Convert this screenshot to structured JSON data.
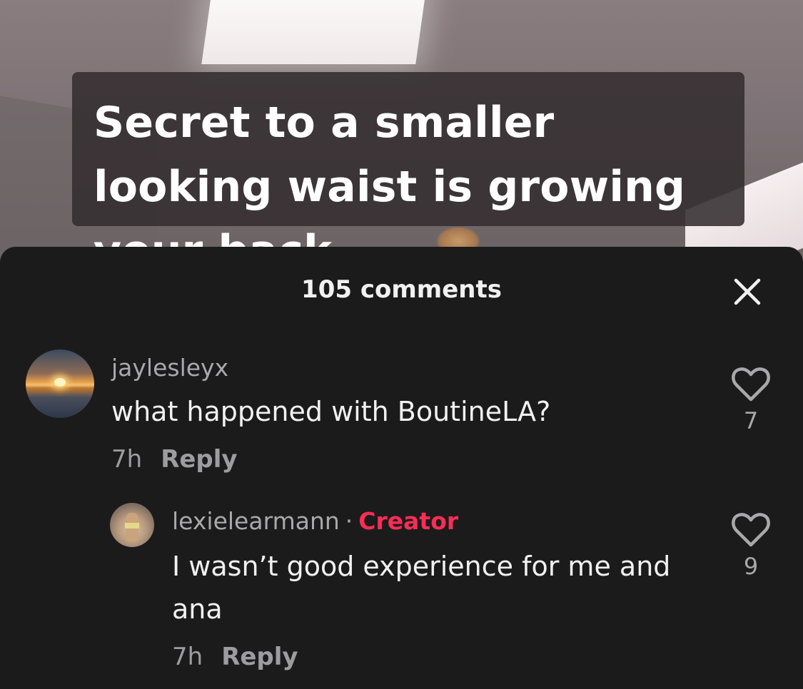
{
  "video": {
    "caption": "Secret to a smaller looking waist is growing your back"
  },
  "comments_panel": {
    "title": "105 comments",
    "close_icon": "close-icon",
    "comments": [
      {
        "username": "jaylesleyx",
        "text": "what happened with BoutineLA?",
        "time": "7h",
        "reply_label": "Reply",
        "likes": "7",
        "avatar_icon": "sunset-avatar"
      },
      {
        "username": "lexielearmann",
        "badge_separator": "·",
        "badge": "Creator",
        "text": "I wasn’t good experience for me and ana",
        "time": "7h",
        "reply_label": "Reply",
        "likes": "9",
        "avatar_icon": "creator-avatar"
      }
    ]
  },
  "colors": {
    "accent_creator": "#fe2c55",
    "sheet_bg": "#1b1b1c"
  }
}
